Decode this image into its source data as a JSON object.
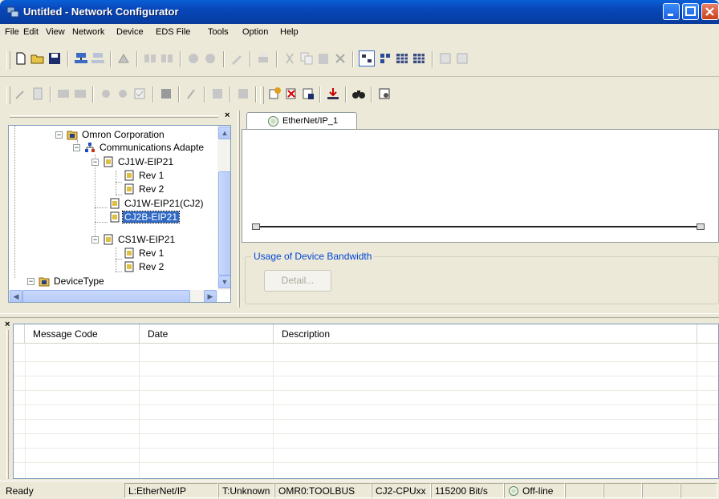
{
  "window": {
    "title": "Untitled - Network Configurator"
  },
  "menu": [
    "File",
    "Edit",
    "View",
    "Network",
    "Device",
    "EDS File",
    "Tools",
    "Option",
    "Help"
  ],
  "tree": {
    "nodes": [
      {
        "label": "Omron Corporation"
      },
      {
        "label": "Communications Adapte"
      },
      {
        "label": "CJ1W-EIP21"
      },
      {
        "label": "Rev 1"
      },
      {
        "label": "Rev 2"
      },
      {
        "label": "CJ1W-EIP21(CJ2)"
      },
      {
        "label": "CJ2B-EIP21"
      },
      {
        "label": "CS1W-EIP21"
      },
      {
        "label": "Rev 1"
      },
      {
        "label": "Rev 2"
      },
      {
        "label": "DeviceType"
      }
    ],
    "close": "×"
  },
  "network": {
    "tab_label": "EtherNet/IP_1",
    "bandwidth_group_label": "Usage of Device Bandwidth",
    "detail_button": "Detail..."
  },
  "messages": {
    "close": "×",
    "columns": [
      "Message Code",
      "Date",
      "Description"
    ]
  },
  "status": {
    "ready": "Ready",
    "network": "L:EtherNet/IP",
    "target": "T:Unknown",
    "port": "OMR0:TOOLBUS",
    "cpu": "CJ2-CPUxx",
    "baud": "115200 Bit/s",
    "connection": "Off-line"
  },
  "colors": {
    "selection": "#316ac5",
    "titlebar": "#0846b8",
    "link": "#0046d5"
  }
}
